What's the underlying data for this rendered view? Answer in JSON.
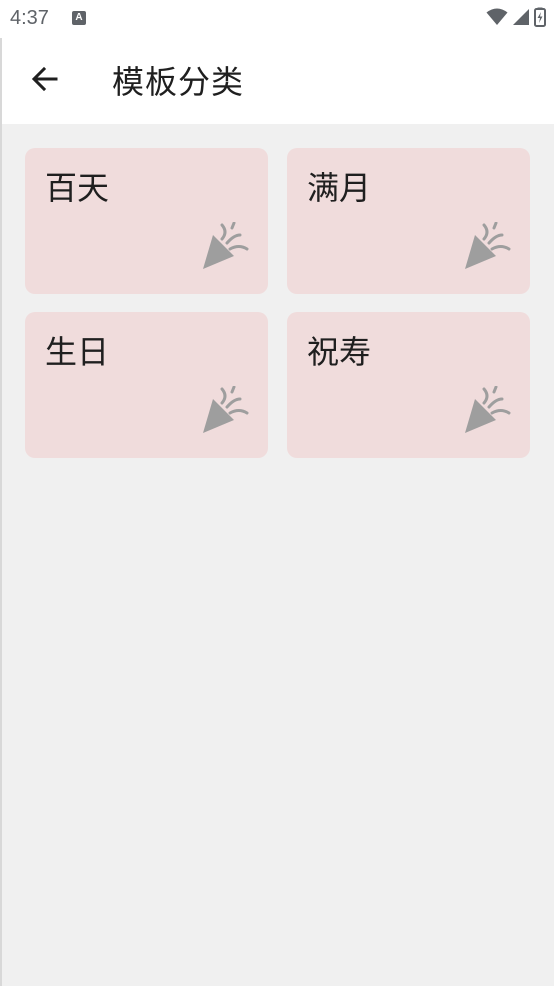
{
  "status_bar": {
    "time": "4:37",
    "notification_icon": "A"
  },
  "app_bar": {
    "title": "模板分类",
    "back_icon": "arrow-left-icon"
  },
  "categories": [
    {
      "label": "百天",
      "icon": "party-popper-icon"
    },
    {
      "label": "满月",
      "icon": "party-popper-icon"
    },
    {
      "label": "生日",
      "icon": "party-popper-icon"
    },
    {
      "label": "祝寿",
      "icon": "party-popper-icon"
    }
  ],
  "colors": {
    "card_background": "#f0dcdc",
    "page_background": "#f0f0f0",
    "icon_gray": "#9e9e9e"
  }
}
